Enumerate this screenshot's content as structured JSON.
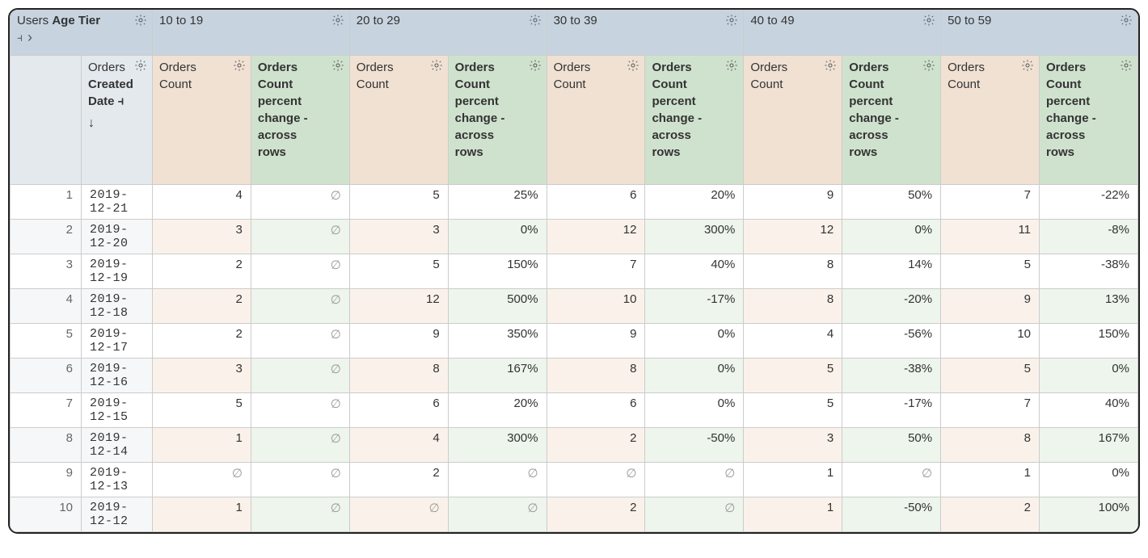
{
  "pivot": {
    "dimension_group": "Users",
    "dimension_field": "Age Tier",
    "buckets": [
      "10 to 19",
      "20 to 29",
      "30 to 39",
      "40 to 49",
      "50 to 59"
    ]
  },
  "row_header": {
    "line1": "Orders",
    "line2": "Created",
    "line3": "Date",
    "sort": "desc"
  },
  "measures": {
    "count_label": [
      "Orders",
      "Count"
    ],
    "pct_label": [
      "Orders",
      "Count",
      "percent",
      "change -",
      "across",
      "rows"
    ]
  },
  "rows": [
    {
      "n": 1,
      "date": "2019-12-21",
      "cells": [
        {
          "c": "4",
          "p": "∅"
        },
        {
          "c": "5",
          "p": "25%"
        },
        {
          "c": "6",
          "p": "20%"
        },
        {
          "c": "9",
          "p": "50%"
        },
        {
          "c": "7",
          "p": "-22%"
        }
      ]
    },
    {
      "n": 2,
      "date": "2019-12-20",
      "cells": [
        {
          "c": "3",
          "p": "∅"
        },
        {
          "c": "3",
          "p": "0%"
        },
        {
          "c": "12",
          "p": "300%"
        },
        {
          "c": "12",
          "p": "0%"
        },
        {
          "c": "11",
          "p": "-8%"
        }
      ]
    },
    {
      "n": 3,
      "date": "2019-12-19",
      "cells": [
        {
          "c": "2",
          "p": "∅"
        },
        {
          "c": "5",
          "p": "150%"
        },
        {
          "c": "7",
          "p": "40%"
        },
        {
          "c": "8",
          "p": "14%"
        },
        {
          "c": "5",
          "p": "-38%"
        }
      ]
    },
    {
      "n": 4,
      "date": "2019-12-18",
      "cells": [
        {
          "c": "2",
          "p": "∅"
        },
        {
          "c": "12",
          "p": "500%"
        },
        {
          "c": "10",
          "p": "-17%"
        },
        {
          "c": "8",
          "p": "-20%"
        },
        {
          "c": "9",
          "p": "13%"
        }
      ]
    },
    {
      "n": 5,
      "date": "2019-12-17",
      "cells": [
        {
          "c": "2",
          "p": "∅"
        },
        {
          "c": "9",
          "p": "350%"
        },
        {
          "c": "9",
          "p": "0%"
        },
        {
          "c": "4",
          "p": "-56%"
        },
        {
          "c": "10",
          "p": "150%"
        }
      ]
    },
    {
      "n": 6,
      "date": "2019-12-16",
      "cells": [
        {
          "c": "3",
          "p": "∅"
        },
        {
          "c": "8",
          "p": "167%"
        },
        {
          "c": "8",
          "p": "0%"
        },
        {
          "c": "5",
          "p": "-38%"
        },
        {
          "c": "5",
          "p": "0%"
        }
      ]
    },
    {
      "n": 7,
      "date": "2019-12-15",
      "cells": [
        {
          "c": "5",
          "p": "∅"
        },
        {
          "c": "6",
          "p": "20%"
        },
        {
          "c": "6",
          "p": "0%"
        },
        {
          "c": "5",
          "p": "-17%"
        },
        {
          "c": "7",
          "p": "40%"
        }
      ]
    },
    {
      "n": 8,
      "date": "2019-12-14",
      "cells": [
        {
          "c": "1",
          "p": "∅"
        },
        {
          "c": "4",
          "p": "300%"
        },
        {
          "c": "2",
          "p": "-50%"
        },
        {
          "c": "3",
          "p": "50%"
        },
        {
          "c": "8",
          "p": "167%"
        }
      ]
    },
    {
      "n": 9,
      "date": "2019-12-13",
      "cells": [
        {
          "c": "∅",
          "p": "∅"
        },
        {
          "c": "2",
          "p": "∅"
        },
        {
          "c": "∅",
          "p": "∅"
        },
        {
          "c": "1",
          "p": "∅"
        },
        {
          "c": "1",
          "p": "0%"
        }
      ]
    },
    {
      "n": 10,
      "date": "2019-12-12",
      "cells": [
        {
          "c": "1",
          "p": "∅"
        },
        {
          "c": "∅",
          "p": "∅"
        },
        {
          "c": "2",
          "p": "∅"
        },
        {
          "c": "1",
          "p": "-50%"
        },
        {
          "c": "2",
          "p": "100%"
        }
      ]
    }
  ],
  "icons": {
    "gear": "gear-icon",
    "pivot_glyph": "❏",
    "chevron_right": "›",
    "sort_desc": "↓",
    "calc_glyph": "❏"
  }
}
